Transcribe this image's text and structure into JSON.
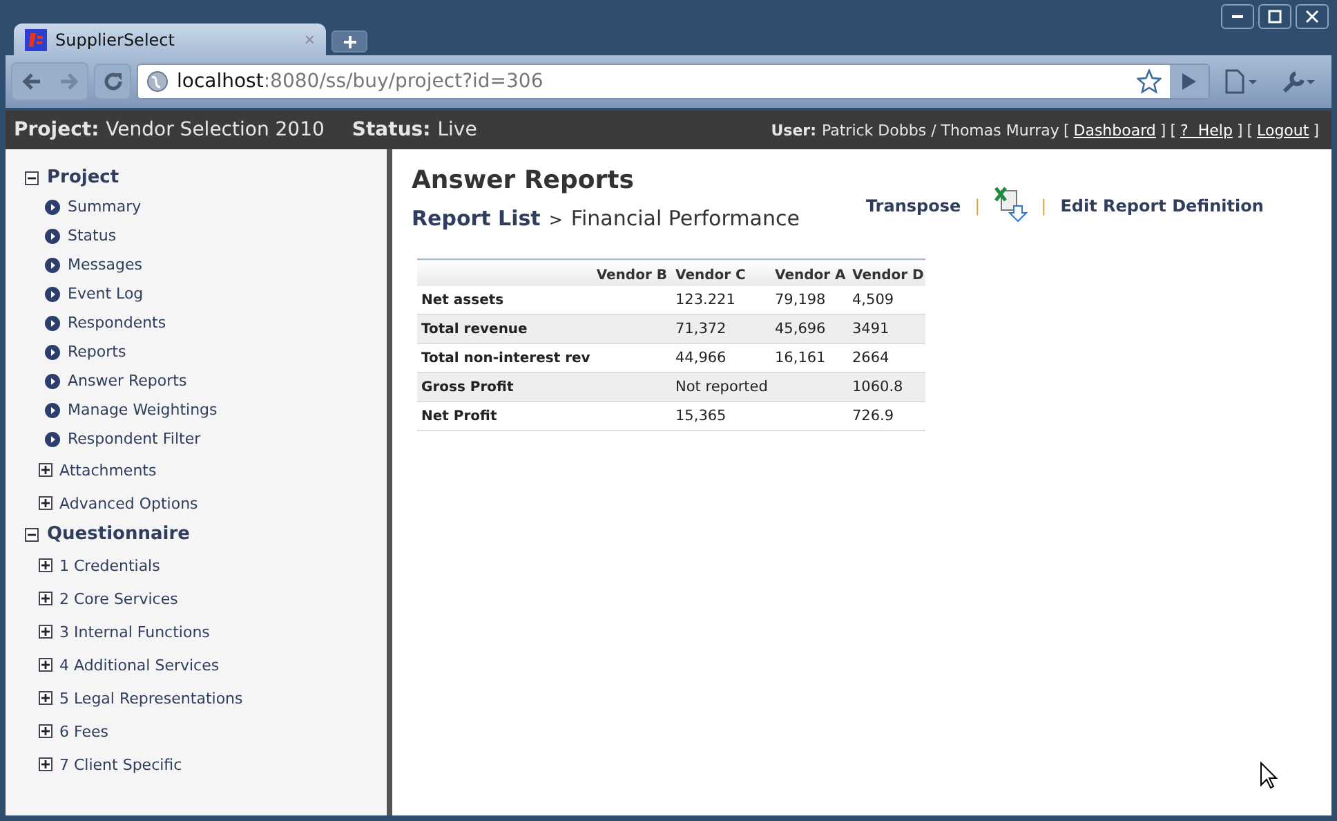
{
  "browser": {
    "tab": {
      "title": "SupplierSelect",
      "close": "×",
      "selected": true
    },
    "url": {
      "host": "localhost",
      "path": ":8080/ss/buy/project?id=306"
    }
  },
  "header": {
    "project_label": "Project:",
    "project": "Vendor Selection 2010",
    "status_label": "Status:",
    "status": "Live",
    "user_label": "User:",
    "user": "Patrick Dobbs / Thomas Murray",
    "links": [
      {
        "open": "[",
        "label": "Dashboard",
        "close": "]"
      },
      {
        "open": "[",
        "label": "?  Help",
        "close": "]"
      },
      {
        "open": "[",
        "label": "Logout",
        "close": "]"
      }
    ]
  },
  "sidebar": [
    {
      "label": "Project",
      "kind": "section",
      "expanded": true,
      "children": [
        {
          "label": "Summary",
          "kind": "link"
        },
        {
          "label": "Status",
          "kind": "link"
        },
        {
          "label": "Messages",
          "kind": "link"
        },
        {
          "label": "Event Log",
          "kind": "link"
        },
        {
          "label": "Respondents",
          "kind": "link"
        },
        {
          "label": "Reports",
          "kind": "link"
        },
        {
          "label": "Answer Reports",
          "kind": "link"
        },
        {
          "label": "Manage Weightings",
          "kind": "link"
        },
        {
          "label": "Respondent Filter",
          "kind": "link"
        },
        {
          "label": "Attachments",
          "kind": "group",
          "expanded": false
        },
        {
          "label": "Advanced Options",
          "kind": "group",
          "expanded": false
        }
      ]
    },
    {
      "label": "Questionnaire",
      "kind": "section",
      "expanded": true,
      "children": [
        {
          "label": "1 Credentials",
          "kind": "group",
          "expanded": false
        },
        {
          "label": "2 Core Services",
          "kind": "group",
          "expanded": false
        },
        {
          "label": "3 Internal Functions",
          "kind": "group",
          "expanded": false
        },
        {
          "label": "4 Additional Services",
          "kind": "group",
          "expanded": false
        },
        {
          "label": "5 Legal Representations",
          "kind": "group",
          "expanded": false
        },
        {
          "label": "6 Fees",
          "kind": "group",
          "expanded": false
        },
        {
          "label": "7 Client Specific",
          "kind": "group",
          "expanded": false
        }
      ]
    }
  ],
  "content": {
    "title": "Answer Reports",
    "breadcrumb": {
      "link": "Report List",
      "separator": ">",
      "current": "Financial Performance"
    },
    "actions": [
      {
        "kind": "link",
        "label": "Transpose"
      },
      {
        "kind": "separator",
        "label": "|"
      },
      {
        "kind": "export"
      },
      {
        "kind": "separator",
        "label": "|"
      },
      {
        "kind": "link",
        "label": "Edit Report Definition"
      }
    ],
    "table": {
      "columns": [
        "Vendor B",
        "Vendor C",
        "Vendor A",
        "Vendor D"
      ],
      "rows": [
        {
          "label": "Net assets",
          "cells": [
            null,
            "123.221",
            "79,198",
            "4,509"
          ]
        },
        {
          "label": "Total revenue",
          "cells": [
            null,
            "71,372",
            "45,696",
            "3491"
          ]
        },
        {
          "label": "Total non-interest rev",
          "cells": [
            null,
            "44,966",
            "16,161",
            "2664"
          ]
        },
        {
          "label": "Gross Profit",
          "cells": [
            null,
            "Not reported",
            null,
            "1060.8"
          ]
        },
        {
          "label": "Net Profit",
          "cells": [
            null,
            "15,365",
            null,
            "726.9"
          ]
        }
      ]
    }
  }
}
